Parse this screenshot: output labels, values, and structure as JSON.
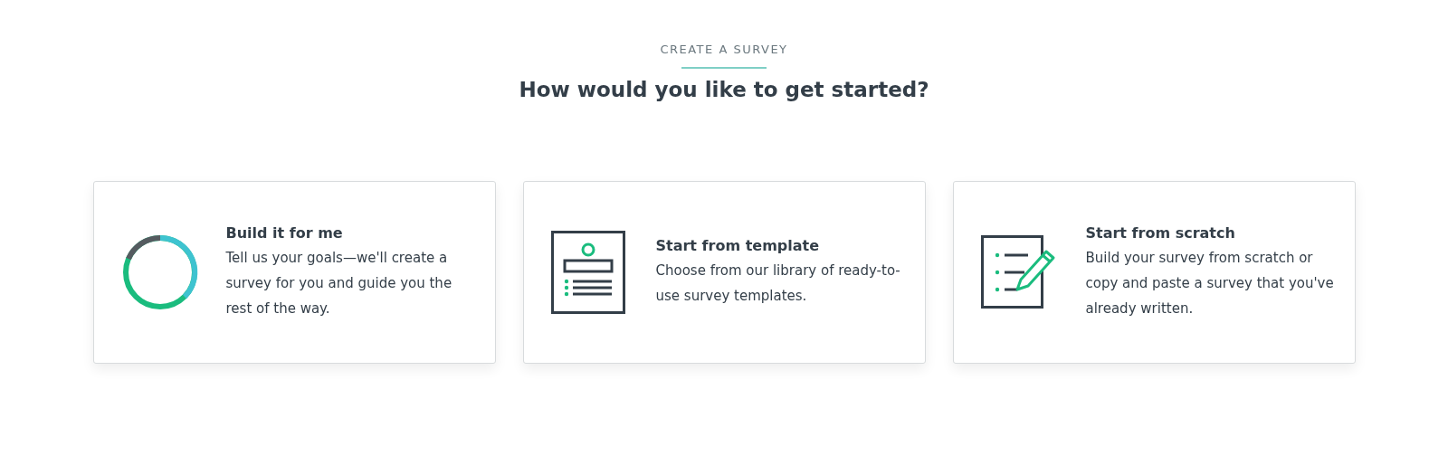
{
  "eyebrow": "CREATE A SURVEY",
  "heading": "How would you like to get started?",
  "options": [
    {
      "kind": "ring",
      "title": "Build it for me",
      "description": "Tell us your goals—we'll create a survey for you and guide you the rest of the way."
    },
    {
      "kind": "template",
      "title": "Start from template",
      "description": "Choose from our library of ready-to-use survey templates."
    },
    {
      "kind": "scratch",
      "title": "Start from scratch",
      "description": "Build your survey from scratch or copy and paste a survey that you've already written."
    }
  ]
}
